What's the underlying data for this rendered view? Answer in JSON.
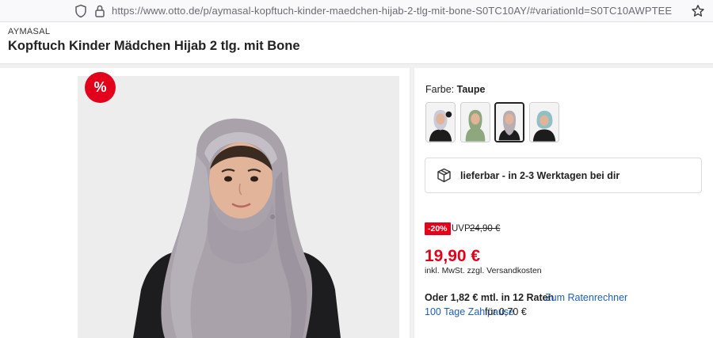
{
  "browser": {
    "url": "https://www.otto.de/p/aymasal-kopftuch-kinder-maedchen-hijab-2-tlg-mit-bone-S0TC10AY/#variationId=S0TC10AWPTEE",
    "shield_icon": "shield-icon",
    "lock_icon": "lock-icon",
    "bookmark_icon": "star-icon"
  },
  "product": {
    "brand": "AYMASAL",
    "title": "Kopftuch Kinder Mädchen Hijab 2 tlg. mit Bone",
    "sale_badge": "%"
  },
  "color_selector": {
    "label": "Farbe:",
    "selected": "Taupe",
    "swatches": [
      {
        "name": "swatch-1",
        "scarf_color": "#c9ccd8"
      },
      {
        "name": "swatch-2",
        "scarf_color": "#8fa77c"
      },
      {
        "name": "swatch-3",
        "scarf_color": "#b6aeb4"
      },
      {
        "name": "swatch-4",
        "scarf_color": "#8fc0c4"
      }
    ]
  },
  "delivery": {
    "text": "lieferbar - in 2-3 Werktagen bei dir",
    "icon": "package-icon"
  },
  "pricing": {
    "discount": "-20%",
    "uvp_label": "UVP",
    "uvp_value": "24,90 €",
    "price": "19,90 €",
    "tax_note": "inkl. MwSt. zzgl. Versandkosten",
    "installment": "Oder 1,82 € mtl. in 12 Raten",
    "installment_link": "Zum Ratenrechner",
    "pause_link": "100 Tage Zahlpause",
    "pause_fee": "für 0,70 €"
  },
  "colors": {
    "accent_red": "#e3001b",
    "link_blue": "#1d5fb9",
    "hijab": "#a9a2aa"
  }
}
